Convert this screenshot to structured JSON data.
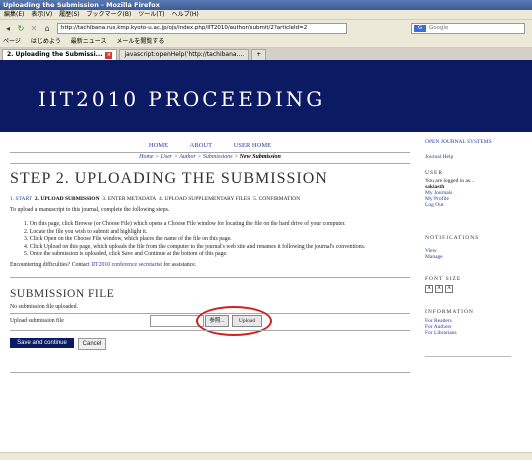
{
  "browser": {
    "window_title": "Uploading the Submission - Mozilla Firefox",
    "menu": [
      "編集(E)",
      "表示(V)",
      "履歴(S)",
      "ブックマーク(B)",
      "ツール(T)",
      "ヘルプ(H)"
    ],
    "url": "http://tachibana.rus.kmp.kyoto-u.ac.jp/ojs/index.php/IIT2010/author/submit/2?articleId=2",
    "search_placeholder": "Google",
    "bookmarks": [
      "ページ",
      "はじめよう",
      "最新ニュース",
      "メールを閲覧する"
    ],
    "tabs": [
      {
        "label": "2. Uploading the Submissi...",
        "active": true
      },
      {
        "label": "javascript:openHelp('http://tachibana....",
        "active": false
      }
    ]
  },
  "site": {
    "title": "IIT2010 PROCEEDING",
    "header_color": "#0b1a63"
  },
  "topnav": {
    "home": "HOME",
    "about": "ABOUT",
    "user_home": "USER HOME"
  },
  "breadcrumb": {
    "home": "Home",
    "user": "User",
    "author": "Author",
    "submissions": "Submissions",
    "current": "New Submission"
  },
  "page": {
    "title": "STEP 2. UPLOADING THE SUBMISSION",
    "steps": [
      "1. START",
      "2. UPLOAD SUBMISSION",
      "3. ENTER METADATA",
      "4. UPLOAD SUPPLEMENTARY FILES",
      "5. CONFIRMATION"
    ],
    "intro": "To upload a manuscript to this journal, complete the following steps.",
    "instructions": [
      "On this page, click Browse (or Choose File) which opens a Choose File window for locating the file on the hard drive of your computer.",
      "Locate the file you wish to submit and highlight it.",
      "Click Open on the Choose File window, which places the name of the file on this page.",
      "Click Upload on this page, which uploads the file from the computer to the journal's web site and renames it following the journal's conventions.",
      "Once the submission is uploaded, click Save and Continue at the bottom of this page."
    ],
    "help_prefix": "Encountering difficulties? Contact ",
    "help_link": "IIT2010 conference secretarist",
    "help_suffix": " for assistance.",
    "submission_file_heading": "SUBMISSION FILE",
    "no_file": "No submission file uploaded.",
    "upload_label": "Upload submission file",
    "browse_label": "参照...",
    "upload_button": "Upload",
    "save_button": "Save and continue",
    "cancel_button": "Cancel"
  },
  "sidebar": {
    "ojs": "OPEN JOURNAL SYSTEMS",
    "journal_help": "Journal Help",
    "user_heading": "USER",
    "logged_in_as": "You are logged in as...",
    "username": "sakiasth",
    "user_links": [
      "My Journals",
      "My Profile",
      "Log Out"
    ],
    "notifications_heading": "NOTIFICATIONS",
    "notif_links": [
      "View",
      "Manage"
    ],
    "font_size_heading": "FONT SIZE",
    "font_buttons": [
      "A",
      "A",
      "A"
    ],
    "information_heading": "INFORMATION",
    "info_links": [
      "For Readers",
      "For Authors",
      "For Librarians"
    ]
  }
}
